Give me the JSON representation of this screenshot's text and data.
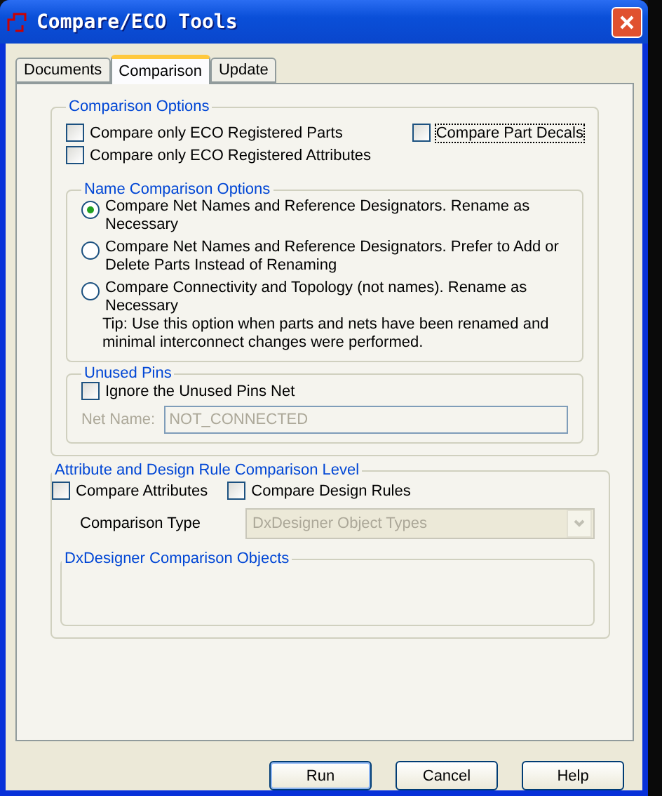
{
  "window": {
    "title": "Compare/ECO Tools"
  },
  "tabs": [
    {
      "label": "Documents",
      "selected": false
    },
    {
      "label": "Comparison",
      "selected": true
    },
    {
      "label": "Update",
      "selected": false
    }
  ],
  "comparison_options": {
    "title": "Comparison Options",
    "checks": [
      {
        "label": "Compare only ECO Registered Parts",
        "checked": false,
        "focused": false
      },
      {
        "label": "Compare only ECO Registered Attributes",
        "checked": false,
        "focused": false
      },
      {
        "label": "Compare Part Decals",
        "checked": false,
        "focused": true
      }
    ]
  },
  "name_comparison": {
    "title": "Name Comparison Options",
    "options": [
      {
        "label": "Compare Net Names and Reference Designators. Rename as Necessary",
        "selected": true
      },
      {
        "label": "Compare Net Names and Reference Designators. Prefer to Add or Delete Parts Instead of Renaming",
        "selected": false
      },
      {
        "label": "Compare Connectivity and Topology (not names). Rename as Necessary",
        "selected": false
      }
    ],
    "tip": "Tip: Use this option when parts and nets have been renamed and minimal interconnect changes were performed."
  },
  "unused_pins": {
    "title": "Unused Pins",
    "check": {
      "label": "Ignore the Unused Pins Net",
      "checked": false
    },
    "net_name": {
      "label": "Net Name:",
      "value": "NOT_CONNECTED",
      "disabled": true
    }
  },
  "attribute_level": {
    "title": "Attribute and Design Rule Comparison Level",
    "checks": [
      {
        "label": "Compare Attributes",
        "checked": false
      },
      {
        "label": "Compare Design Rules",
        "checked": false
      }
    ],
    "comparison_type": {
      "label": "Comparison Type",
      "value": "DxDesigner Object Types",
      "disabled": true
    },
    "objects_group": {
      "title": "DxDesigner Comparison Objects"
    }
  },
  "buttons": [
    {
      "label": "Run",
      "default": true
    },
    {
      "label": "Cancel",
      "default": false
    },
    {
      "label": "Help",
      "default": false
    }
  ]
}
